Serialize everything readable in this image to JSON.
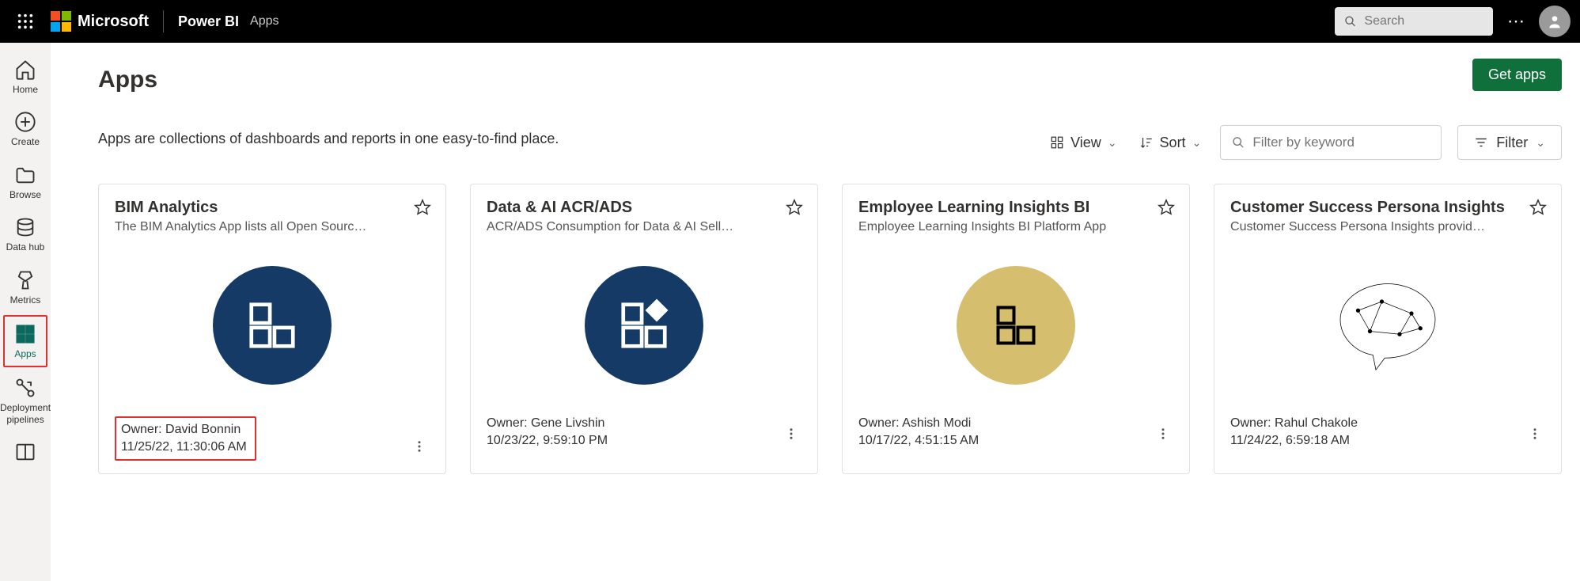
{
  "header": {
    "brand": "Microsoft",
    "product": "Power BI",
    "section": "Apps",
    "search_placeholder": "Search"
  },
  "nav": {
    "home": "Home",
    "create": "Create",
    "browse": "Browse",
    "datahub": "Data hub",
    "metrics": "Metrics",
    "apps": "Apps",
    "pipelines": "Deployment pipelines"
  },
  "page": {
    "title": "Apps",
    "subtitle": "Apps are collections of dashboards and reports in one easy-to-find place.",
    "get_apps": "Get apps",
    "view": "View",
    "sort": "Sort",
    "filter_placeholder": "Filter by keyword",
    "filter": "Filter"
  },
  "cards": [
    {
      "title": "BIM Analytics",
      "desc": "The BIM Analytics App lists all Open Sourc…",
      "owner_label": "Owner: David Bonnin",
      "ts": "11/25/22, 11:30:06 AM",
      "icon": "app-navy",
      "highlight": true
    },
    {
      "title": "Data & AI ACR/ADS",
      "desc": "ACR/ADS Consumption for Data & AI Sell…",
      "owner_label": "Owner: Gene Livshin",
      "ts": "10/23/22, 9:59:10 PM",
      "icon": "app-navy-alt",
      "highlight": false
    },
    {
      "title": "Employee Learning Insights BI",
      "desc": "Employee Learning Insights BI Platform App",
      "owner_label": "Owner: Ashish Modi",
      "ts": "10/17/22, 4:51:15 AM",
      "icon": "app-gold",
      "highlight": false
    },
    {
      "title": "Customer Success Persona Insights",
      "desc": "Customer Success Persona Insights provid…",
      "owner_label": "Owner: Rahul Chakole",
      "ts": "11/24/22, 6:59:18 AM",
      "icon": "brain",
      "highlight": false
    }
  ]
}
